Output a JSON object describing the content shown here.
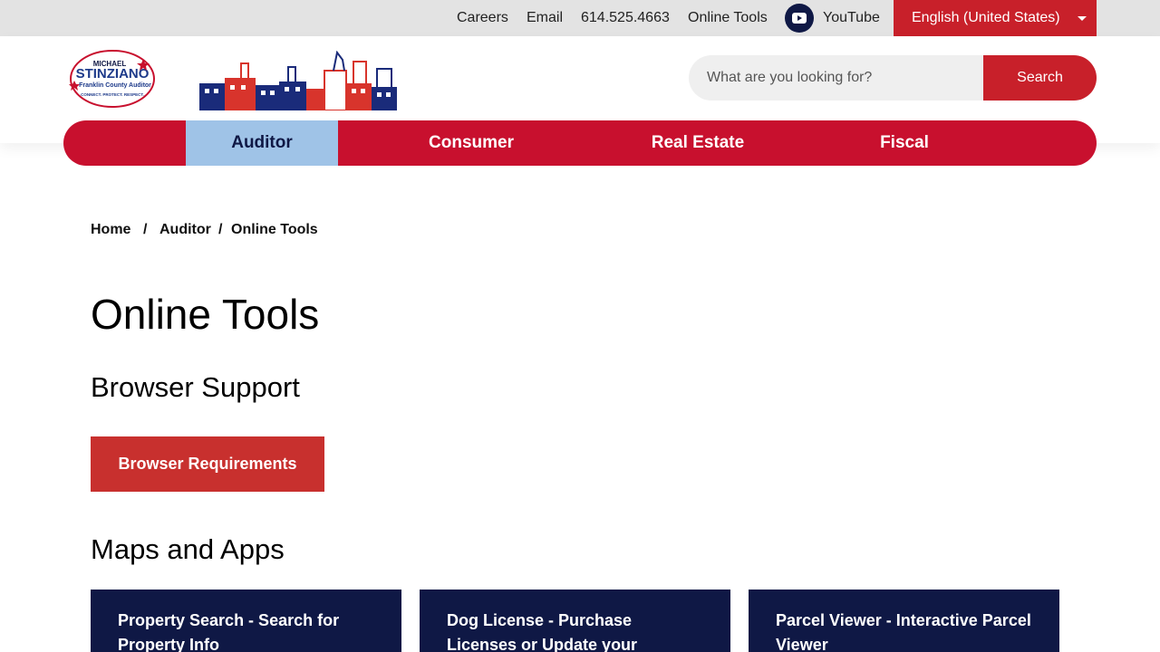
{
  "utility_bar": {
    "links": [
      "Careers",
      "Email",
      "614.525.4663",
      "Online Tools"
    ],
    "youtube_label": "YouTube",
    "language": "English (United States)"
  },
  "header": {
    "logo_lines": [
      "MICHAEL",
      "STINZIANO",
      "Franklin County Auditor",
      "CONNECT. PROTECT. RESPECT."
    ],
    "search_placeholder": "What are you looking for?",
    "search_button": "Search"
  },
  "nav": {
    "items": [
      "Auditor",
      "Consumer",
      "Real Estate",
      "Fiscal"
    ],
    "active": "Auditor"
  },
  "breadcrumb": {
    "items": [
      "Home",
      "Auditor",
      "Online Tools"
    ],
    "separator": "/"
  },
  "page": {
    "title": "Online Tools",
    "browser_support_heading": "Browser Support",
    "browser_requirements_button": "Browser Requirements",
    "maps_heading": "Maps and Apps",
    "cards": [
      "Property Search - Search for Property Info",
      "Dog License - Purchase Licenses or Update your",
      "Parcel Viewer - Interactive Parcel Viewer"
    ]
  },
  "colors": {
    "brand_red": "#c8102e",
    "button_red": "#c8302e",
    "navy": "#0f1845",
    "active_nav": "#9fc3e7",
    "utility_bg": "#e3e3e3"
  }
}
